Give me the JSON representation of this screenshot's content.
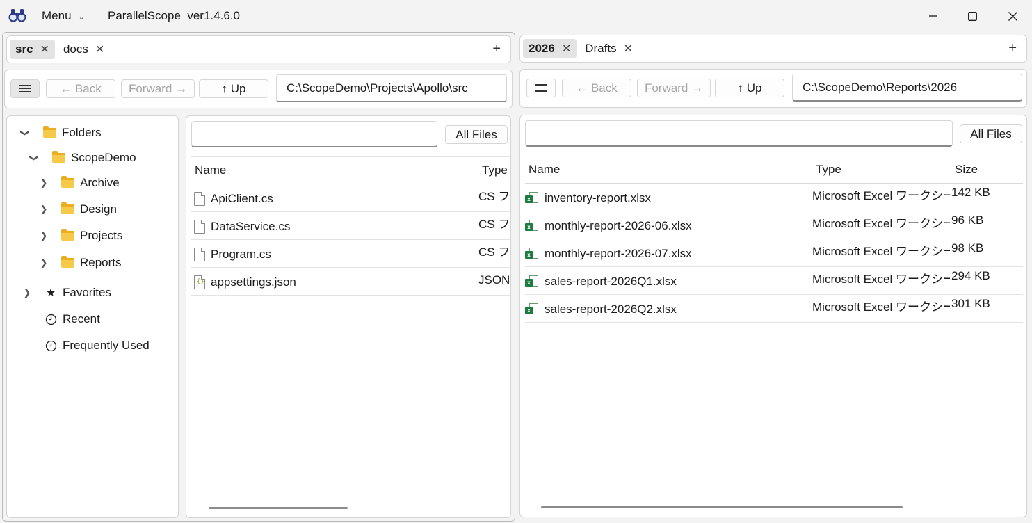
{
  "app": {
    "menu_label": "Menu",
    "title": "ParallelScope  ver1.4.6.0",
    "icon": "binoculars-icon"
  },
  "window": {
    "minimize": "─",
    "maximize": "▢",
    "close": "✕"
  },
  "left": {
    "tabs": [
      {
        "label": "src",
        "active": true
      },
      {
        "label": "docs",
        "active": false
      }
    ],
    "nav": {
      "back": "← Back",
      "forward": "Forward →",
      "up": "↑ Up",
      "path": "C:\\ScopeDemo\\Projects\\Apollo\\src"
    },
    "tree": {
      "root": "Folders",
      "demo": "ScopeDemo",
      "children": [
        "Archive",
        "Design",
        "Projects",
        "Reports"
      ],
      "favorites": "Favorites",
      "recent": "Recent",
      "frequent": "Frequently Used"
    },
    "filter_label": "All Files",
    "columns": {
      "name": "Name",
      "type": "Type"
    },
    "files": [
      {
        "name": "ApiClient.cs",
        "type": "CS ファイル",
        "icon": "file-icon"
      },
      {
        "name": "DataService.cs",
        "type": "CS ファイル",
        "icon": "file-icon"
      },
      {
        "name": "Program.cs",
        "type": "CS ファイル",
        "icon": "file-icon"
      },
      {
        "name": "appsettings.json",
        "type": "JSON ファイル",
        "icon": "json-file-icon"
      }
    ]
  },
  "right": {
    "tabs": [
      {
        "label": "2026",
        "active": true
      },
      {
        "label": "Drafts",
        "active": false
      }
    ],
    "nav": {
      "back": "← Back",
      "forward": "Forward →",
      "up": "↑ Up",
      "path": "C:\\ScopeDemo\\Reports\\2026"
    },
    "filter_label": "All Files",
    "columns": {
      "name": "Name",
      "type": "Type",
      "size": "Size"
    },
    "files": [
      {
        "name": "inventory-report.xlsx",
        "type": "Microsoft Excel ワークシート",
        "size": "142 KB"
      },
      {
        "name": "monthly-report-2026-06.xlsx",
        "type": "Microsoft Excel ワークシート",
        "size": "96 KB"
      },
      {
        "name": "monthly-report-2026-07.xlsx",
        "type": "Microsoft Excel ワークシート",
        "size": "98 KB"
      },
      {
        "name": "sales-report-2026Q1.xlsx",
        "type": "Microsoft Excel ワークシート",
        "size": "294 KB"
      },
      {
        "name": "sales-report-2026Q2.xlsx",
        "type": "Microsoft Excel ワークシート",
        "size": "301 KB"
      }
    ]
  }
}
